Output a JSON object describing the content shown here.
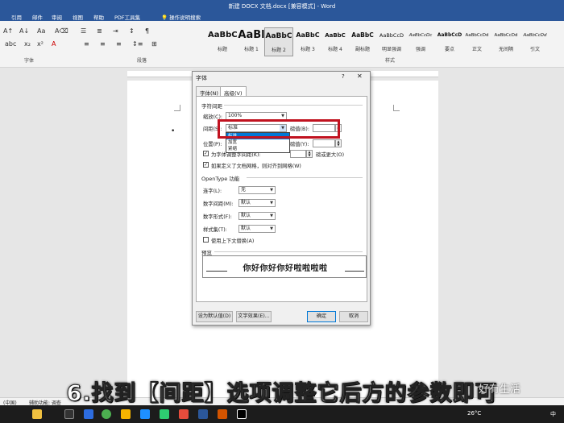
{
  "app": {
    "title": "新建 DOCX 文档.docx [兼容模式] - Word",
    "tabs": [
      "引用",
      "邮件",
      "审阅",
      "视图",
      "帮助",
      "PDF工具集"
    ],
    "tell_me": "操作说明搜索"
  },
  "ribbon": {
    "groups": {
      "font": "字体",
      "paragraph": "段落",
      "styles": "样式"
    },
    "styles": [
      {
        "sample": "AaBbC",
        "name": "标题"
      },
      {
        "sample": "AaBl",
        "name": "标题 1"
      },
      {
        "sample": "AaBbC",
        "name": "标题 2"
      },
      {
        "sample": "AaBbC",
        "name": "标题 3"
      },
      {
        "sample": "AaBbC",
        "name": "标题 4"
      },
      {
        "sample": "AaBbC",
        "name": "副标题"
      },
      {
        "sample": "AaBbCcD",
        "name": "明显强调"
      },
      {
        "sample": "AaBbCcDc",
        "name": "强调"
      },
      {
        "sample": "AaBbCcD",
        "name": "要点"
      },
      {
        "sample": "AaBbCcDd",
        "name": "正文"
      },
      {
        "sample": "AaBbCcDd",
        "name": "无间隔"
      },
      {
        "sample": "AaBbCcDd",
        "name": "引文"
      }
    ]
  },
  "dialog": {
    "title": "字体",
    "help": "?",
    "close": "✕",
    "tabs": [
      "字体(N)",
      "高级(V)"
    ],
    "char_spacing_section": "字符间距",
    "scale_label": "缩放(C):",
    "scale_value": "100%",
    "spacing_label": "间距(S):",
    "spacing_value": "标准",
    "points_label": "磅值(B):",
    "points_value": "",
    "spacing_options": [
      "标准",
      "加宽",
      "紧缩"
    ],
    "position_label": "位置(P):",
    "position_points_label": "磅值(Y):",
    "kerning_label": "为字体调整字间距(K):",
    "kerning_suffix": "磅或更大(O)",
    "grid_label": "如果定义了文档网格，则对齐到网格(W)",
    "opentype_section": "OpenType 功能",
    "ligatures_label": "连字(L):",
    "ligatures_value": "无",
    "num_spacing_label": "数字间距(M):",
    "num_spacing_value": "默认",
    "num_forms_label": "数字形式(F):",
    "num_forms_value": "默认",
    "style_sets_label": "样式集(T):",
    "style_sets_value": "默认",
    "contextual_label": "使用上下文替换(A)",
    "preview_section": "预览",
    "preview_text": "你好你好你好啦啦啦啦",
    "btn_default": "设为默认值(D)",
    "btn_effects": "文字效果(E)...",
    "btn_ok": "确定",
    "btn_cancel": "取消"
  },
  "caption": "6.找到【间距】选项调整它后方的参数即可",
  "watermark": "好有生活",
  "statusbar": {
    "lang": "(中国)",
    "accessibility": "辅助功能: 调查"
  },
  "taskbar": {
    "weather": "26°C",
    "ime": "中"
  }
}
